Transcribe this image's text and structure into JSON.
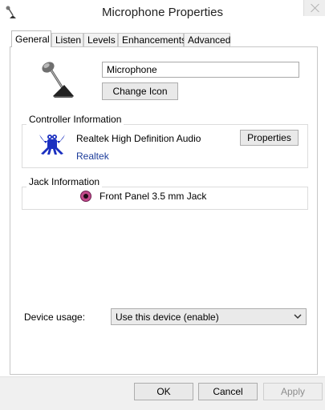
{
  "window": {
    "title": "Microphone Properties"
  },
  "tabs": [
    {
      "label": "General",
      "active": true
    },
    {
      "label": "Listen"
    },
    {
      "label": "Levels"
    },
    {
      "label": "Enhancements"
    },
    {
      "label": "Advanced"
    }
  ],
  "device": {
    "icon": "microphone-icon",
    "name": "Microphone",
    "change_icon_label": "Change Icon"
  },
  "controller": {
    "group_label": "Controller Information",
    "logo_icon": "realtek-crab-icon",
    "name": "Realtek High Definition Audio",
    "vendor": "Realtek",
    "properties_label": "Properties"
  },
  "jack": {
    "group_label": "Jack Information",
    "color": "#c24a8a",
    "text": "Front Panel 3.5 mm Jack"
  },
  "usage": {
    "label": "Device usage:",
    "selected": "Use this device (enable)"
  },
  "buttons": {
    "ok": "OK",
    "cancel": "Cancel",
    "apply": "Apply"
  },
  "colors": {
    "link": "#1c3c9a",
    "logo_blue": "#1a2fc0"
  }
}
